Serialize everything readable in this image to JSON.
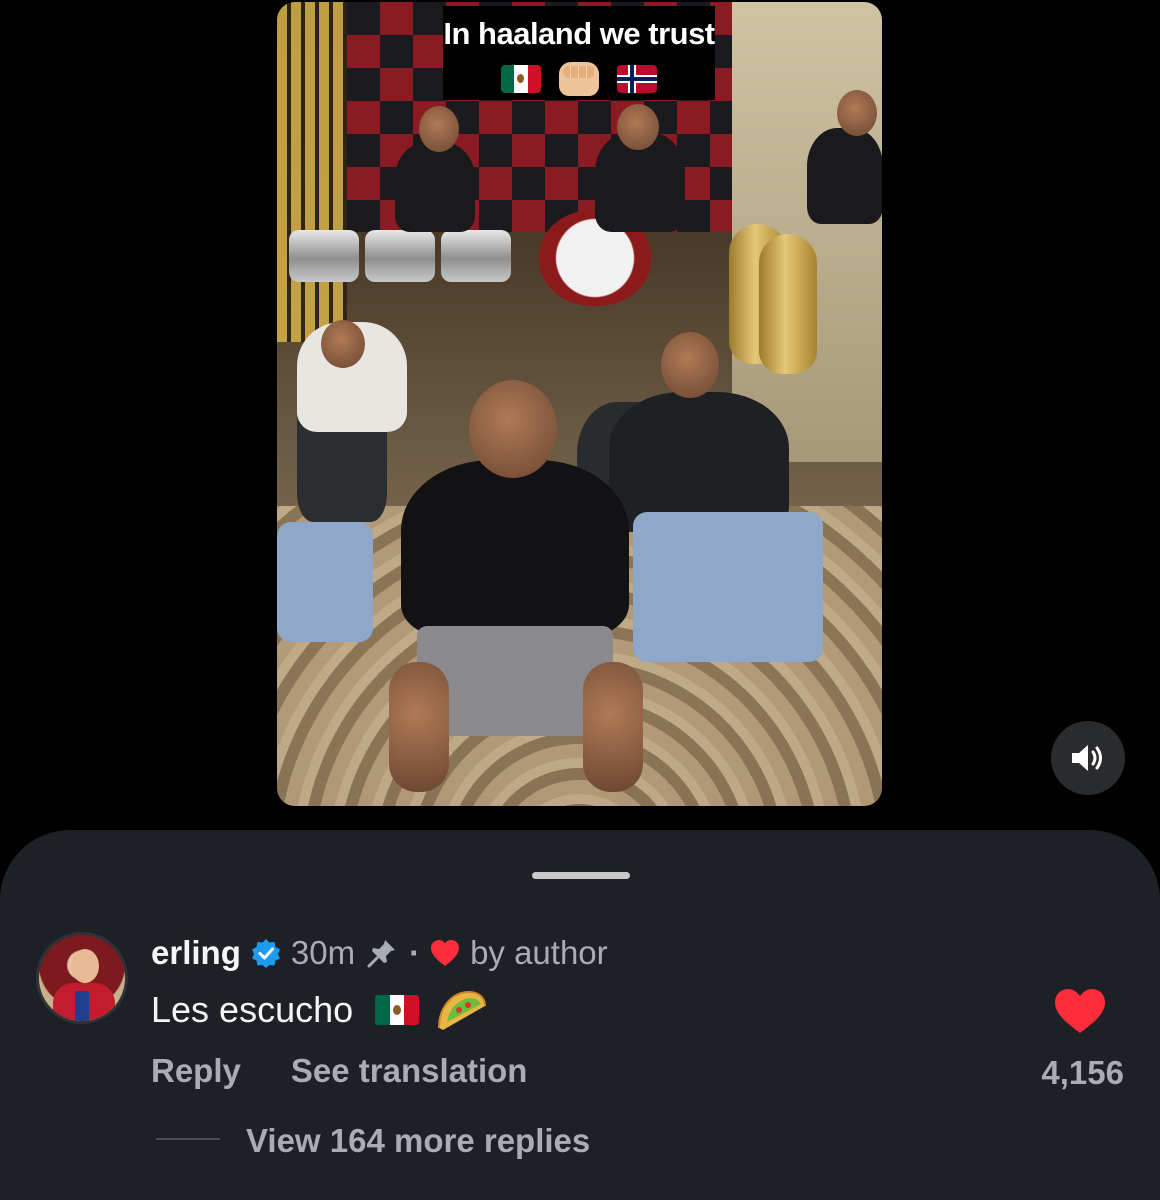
{
  "video": {
    "caption": "In haaland we trust",
    "caption_emojis": [
      "mexico-flag",
      "fist-bump",
      "norway-flag"
    ]
  },
  "controls": {
    "volume_icon": "speaker-on-icon"
  },
  "comment": {
    "username": "erling",
    "verified": true,
    "time": "30m",
    "pinned": true,
    "separator": "·",
    "liked_by_author_label": "by author",
    "text": "Les escucho",
    "text_emojis": [
      "mexico-flag",
      "taco"
    ],
    "reply_label": "Reply",
    "translate_label": "See translation",
    "like_count": "4,156",
    "view_replies_label": "View 164 more replies"
  },
  "colors": {
    "background": "#000000",
    "sheet": "#1d2024",
    "primary_text": "#f3f5f6",
    "secondary_text": "#a8adb3",
    "heart": "#ff2d3b",
    "verified": "#1d9bf0"
  }
}
